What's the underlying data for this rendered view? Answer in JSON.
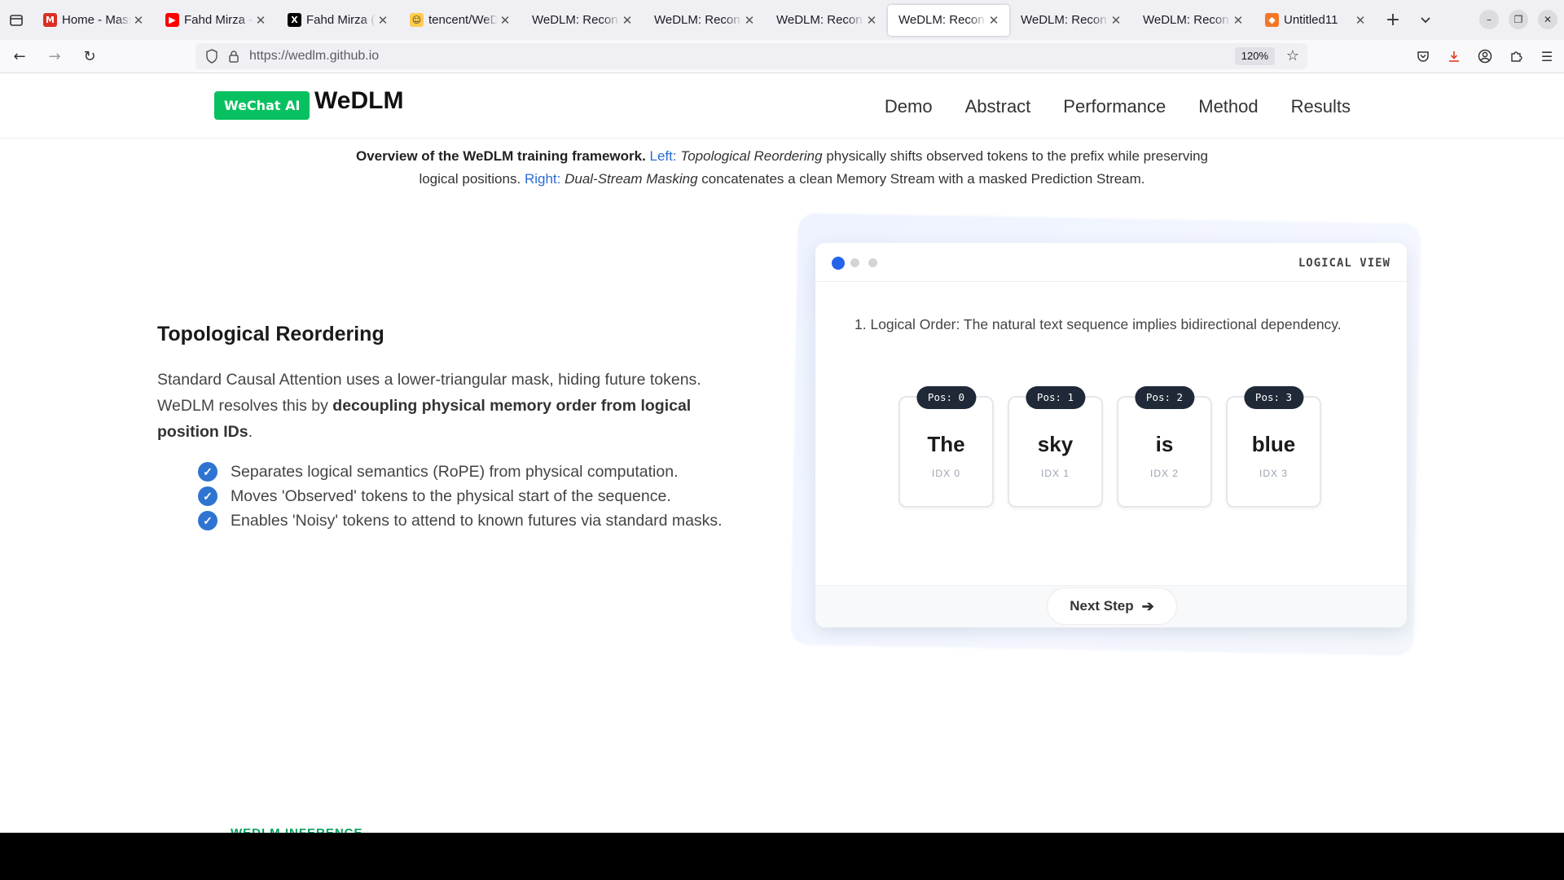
{
  "browser": {
    "tabs": [
      {
        "title": "Home - Mass",
        "icon": "gmail-icon",
        "color": "#d93025",
        "glyph": "M",
        "active": false
      },
      {
        "title": "Fahd Mirza -",
        "icon": "youtube-icon",
        "color": "#ff0000",
        "glyph": "▶",
        "active": false
      },
      {
        "title": "Fahd Mirza (@",
        "icon": "x-icon",
        "color": "#000000",
        "glyph": "X",
        "active": false
      },
      {
        "title": "tencent/WeD",
        "icon": "huggingface-icon",
        "color": "#ffcc4d",
        "glyph": "☺",
        "active": false
      },
      {
        "title": "WeDLM: Recon",
        "icon": "",
        "color": "",
        "glyph": "",
        "active": false
      },
      {
        "title": "WeDLM: Recon",
        "icon": "",
        "color": "",
        "glyph": "",
        "active": false
      },
      {
        "title": "WeDLM: Recon",
        "icon": "",
        "color": "",
        "glyph": "",
        "active": false
      },
      {
        "title": "WeDLM: Recon",
        "icon": "",
        "color": "",
        "glyph": "",
        "active": true
      },
      {
        "title": "WeDLM: Recon",
        "icon": "",
        "color": "",
        "glyph": "",
        "active": false
      },
      {
        "title": "WeDLM: Recon",
        "icon": "",
        "color": "",
        "glyph": "",
        "active": false
      },
      {
        "title": "Untitled11",
        "icon": "jupyter-icon",
        "color": "#f37726",
        "glyph": "◆",
        "active": false
      }
    ],
    "url": "https://wedlm.github.io",
    "zoom": "120%"
  },
  "site": {
    "badge": "WeChat AI",
    "name": "WeDLM",
    "nav": [
      "Demo",
      "Abstract",
      "Performance",
      "Method",
      "Results"
    ]
  },
  "caption": {
    "bold": "Overview of the WeDLM training framework.",
    "left_label": "Left:",
    "left_term": "Topological Reordering",
    "left_text": "physically shifts observed tokens to the prefix while preserving logical positions.",
    "right_label": "Right:",
    "right_term": "Dual-Stream Masking",
    "right_text": "concatenates a clean Memory Stream with a masked Prediction Stream."
  },
  "section": {
    "title": "Topological Reordering",
    "body_plain": "Standard Causal Attention uses a lower-triangular mask, hiding future tokens. WeDLM resolves this by ",
    "body_bold": "decoupling physical memory order from logical position IDs",
    "body_end": ".",
    "bullets": [
      "Separates logical semantics (RoPE) from physical computation.",
      "Moves 'Observed' tokens to the physical start of the sequence.",
      "Enables 'Noisy' tokens to attend to known futures via standard masks."
    ]
  },
  "diagram": {
    "view_label": "LOGICAL VIEW",
    "step_count": 3,
    "active_step": 0,
    "step_text": "1. Logical Order: The natural text sequence implies bidirectional dependency.",
    "tokens": [
      {
        "pos": "Pos: 0",
        "word": "The",
        "idx": "IDX 0"
      },
      {
        "pos": "Pos: 1",
        "word": "sky",
        "idx": "IDX 1"
      },
      {
        "pos": "Pos: 2",
        "word": "is",
        "idx": "IDX 2"
      },
      {
        "pos": "Pos: 3",
        "word": "blue",
        "idx": "IDX 3"
      }
    ],
    "next_label": "Next Step"
  },
  "peek_heading": "WEDLM INFERENCE",
  "colors": {
    "brand_green": "#07c160",
    "accent_blue": "#2563eb",
    "link_blue": "#2b6cd4"
  }
}
